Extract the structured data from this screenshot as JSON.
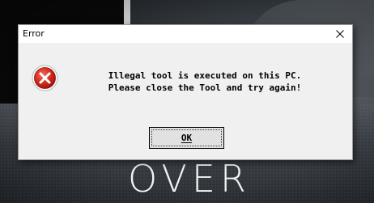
{
  "background": {
    "overlay_text": "OVER"
  },
  "dialog": {
    "title": "Error",
    "close_icon": "close-icon",
    "status_icon": "error-icon",
    "message_lines": [
      "Illegal tool is executed on this PC.",
      "Please close the Tool and try again!"
    ],
    "ok_button_label": "OK"
  },
  "colors": {
    "error_red": "#d42a1e",
    "dialog_bg": "#f0f0f0",
    "button_bg": "#e1e1e1"
  }
}
